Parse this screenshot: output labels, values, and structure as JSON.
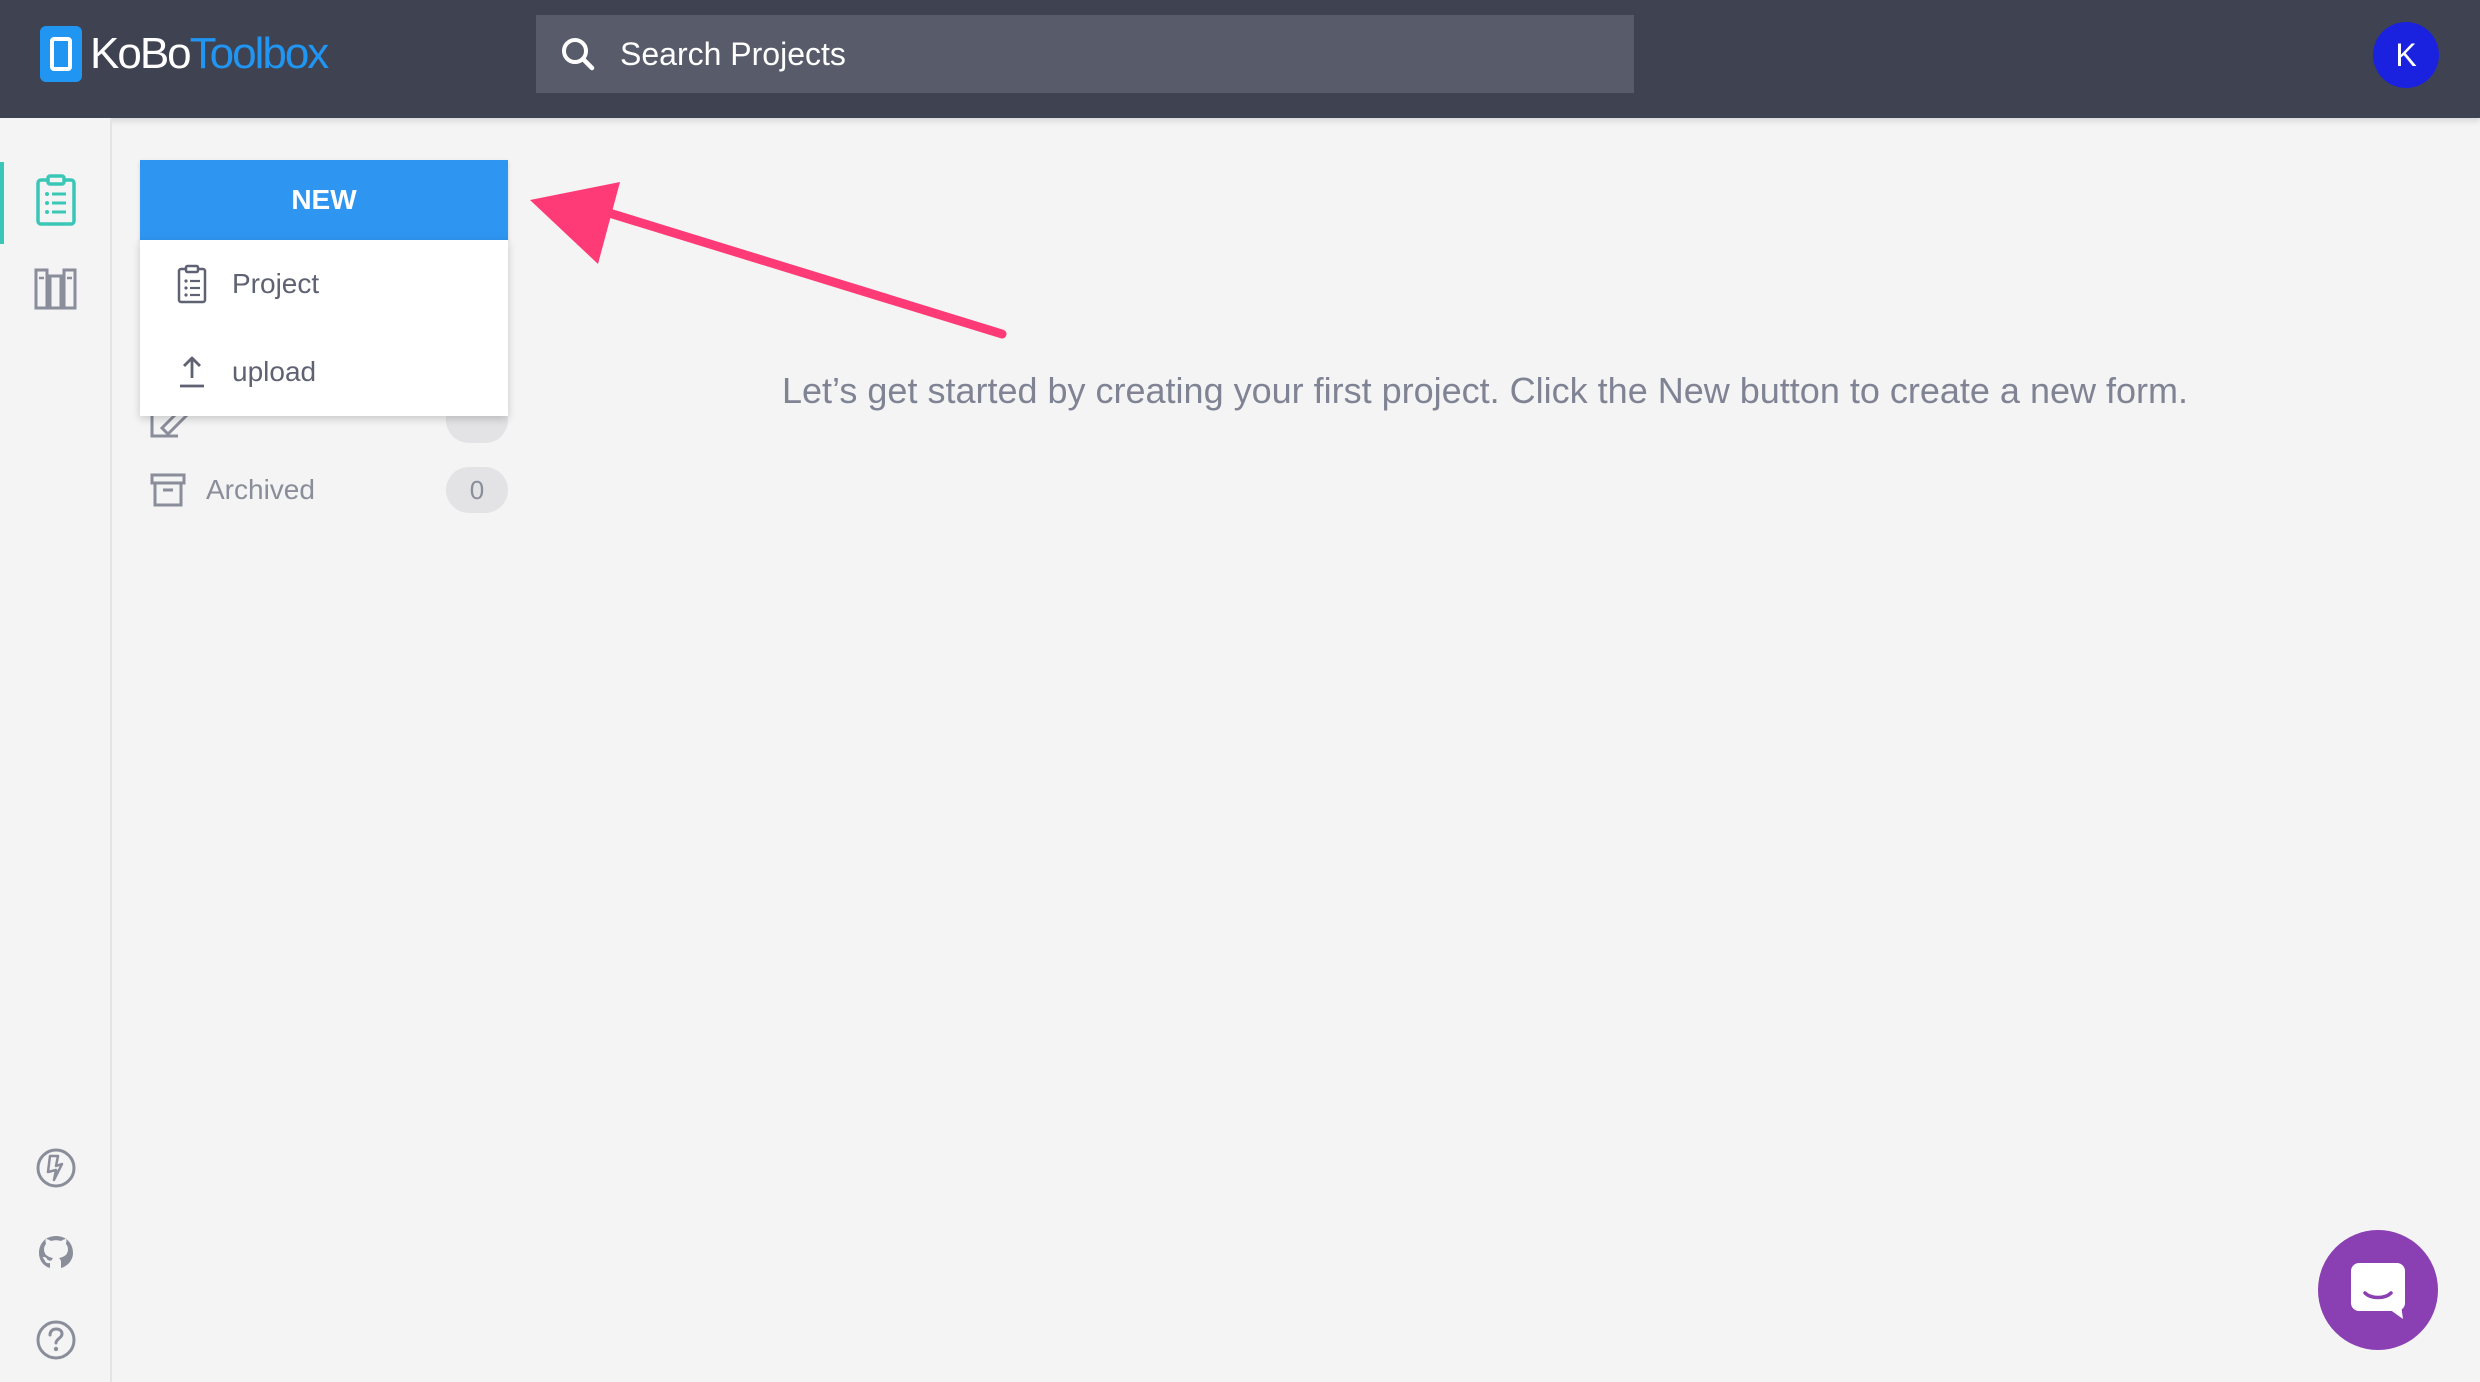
{
  "header": {
    "logo": {
      "part1": "KoBo",
      "part2": "Toolbox"
    },
    "search": {
      "icon": "search-icon",
      "placeholder": "Search Projects"
    },
    "avatar_initial": "K"
  },
  "rail": {
    "items": [
      {
        "name": "projects-icon",
        "active": true
      },
      {
        "name": "library-icon",
        "active": false
      }
    ],
    "bottom": [
      {
        "name": "support-icon"
      },
      {
        "name": "github-icon"
      },
      {
        "name": "help-icon"
      }
    ]
  },
  "new_menu": {
    "button_label": "NEW",
    "items": [
      {
        "label": "Project",
        "icon": "clipboard-icon"
      },
      {
        "label": "upload",
        "icon": "upload-icon"
      }
    ]
  },
  "sidebar": {
    "archived": {
      "label": "Archived",
      "count": "0",
      "icon": "archive-icon"
    }
  },
  "main": {
    "empty_message": "Let’s get started by creating your first project. Click the New button to create a new form."
  },
  "colors": {
    "header_bg": "#3f4250",
    "accent_blue": "#2e95f0",
    "accent_teal": "#3bc7b8",
    "annotation_arrow": "#ff3b77",
    "chat_purple": "#8a3fb2"
  }
}
